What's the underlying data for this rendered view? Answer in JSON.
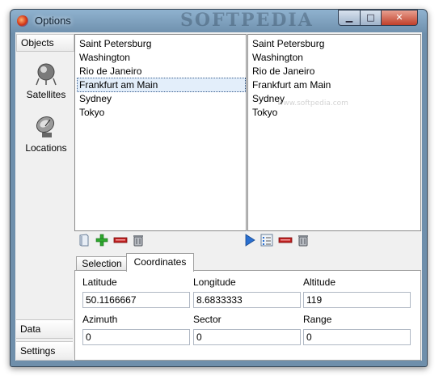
{
  "window": {
    "title": "Options",
    "watermark": "SOFTPEDIA"
  },
  "titlebar_buttons": {
    "minimize": "▁",
    "maximize": "□",
    "close": "✕"
  },
  "nav": {
    "header": "Objects",
    "items": [
      {
        "label": "Satellites",
        "icon": "satellite-icon"
      },
      {
        "label": "Locations",
        "icon": "dish-icon"
      }
    ],
    "bottom": [
      "Data",
      "Settings"
    ]
  },
  "left_list": {
    "items": [
      "Saint Petersburg",
      "Washington",
      "Rio de Janeiro",
      "Frankfurt am Main",
      "Sydney",
      "Tokyo"
    ],
    "selected": "Frankfurt am Main"
  },
  "right_list": {
    "items": [
      "Saint Petersburg",
      "Washington",
      "Rio de Janeiro",
      "Frankfurt am Main",
      "Sydney",
      "Tokyo"
    ],
    "watermark": "www.softpedia.com"
  },
  "left_toolbar": [
    "book-icon",
    "add-icon",
    "remove-icon",
    "delete-icon"
  ],
  "right_toolbar": [
    "play-icon",
    "list-icon",
    "remove-icon",
    "delete-icon"
  ],
  "tabs": {
    "selection": "Selection",
    "coordinates": "Coordinates",
    "active": "Coordinates"
  },
  "coordinates": {
    "latitude_label": "Latitude",
    "latitude": "50.1166667",
    "longitude_label": "Longitude",
    "longitude": "8.6833333",
    "altitude_label": "Altitude",
    "altitude": "119",
    "azimuth_label": "Azimuth",
    "azimuth": "0",
    "sector_label": "Sector",
    "sector": "0",
    "range_label": "Range",
    "range": "0"
  },
  "colors": {
    "selected_bg": "#e3eefa",
    "add_green": "#2ea82e",
    "remove_red": "#c02020",
    "play_blue": "#2a6fd0"
  }
}
